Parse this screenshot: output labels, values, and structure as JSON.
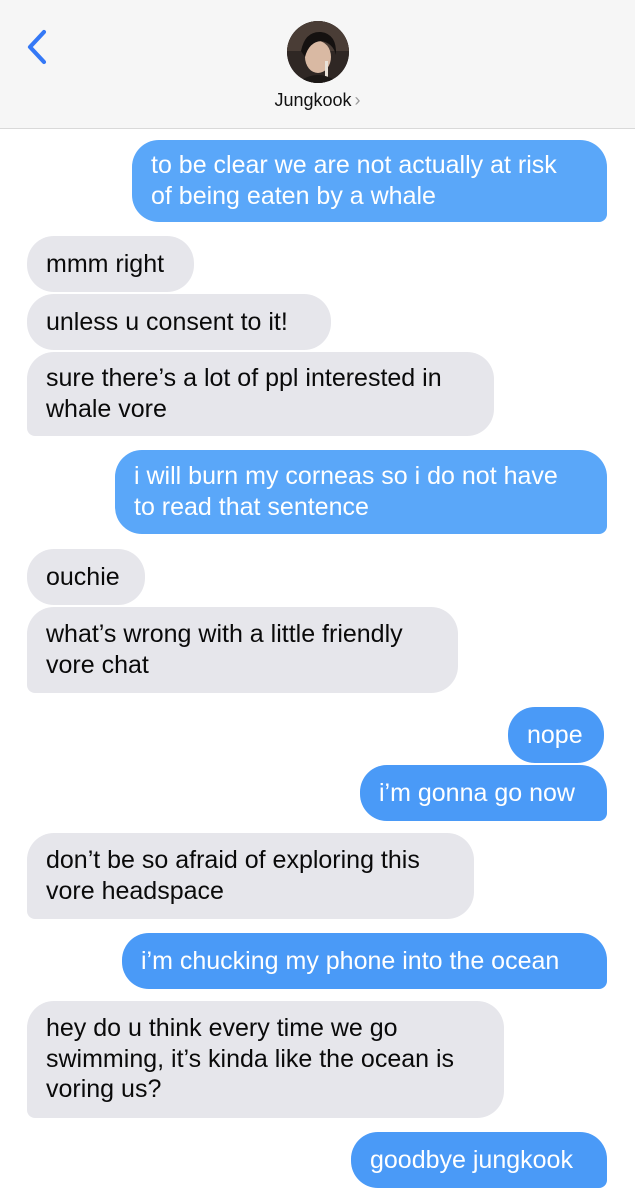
{
  "header": {
    "back_icon": "chevron-left-icon",
    "contact_name": "Jungkook",
    "contact_chevron": "›",
    "accent": "#3478f6"
  },
  "colors": {
    "incoming_bubble": "#e6e6eb",
    "outgoing_bubble": "#4a9af7"
  },
  "messages": [
    {
      "dir": "out",
      "text": "to be clear we are not actually at risk\nof being eaten by a whale"
    },
    {
      "dir": "in",
      "text": "mmm right"
    },
    {
      "dir": "in",
      "text": "unless u consent to it!"
    },
    {
      "dir": "in",
      "text": "sure there’s a lot of ppl interested in\nwhale vore"
    },
    {
      "dir": "out",
      "text": "i will burn my corneas so i do not have\nto read that sentence"
    },
    {
      "dir": "in",
      "text": "ouchie"
    },
    {
      "dir": "in",
      "text": "what’s wrong with a little friendly\nvore chat"
    },
    {
      "dir": "out",
      "text": "nope"
    },
    {
      "dir": "out",
      "text": "i’m gonna go now"
    },
    {
      "dir": "in",
      "text": "don’t be so afraid of exploring this\nvore headspace"
    },
    {
      "dir": "out",
      "text": "i’m chucking my phone into the ocean"
    },
    {
      "dir": "in",
      "text": "hey do u think every time we go\nswimming, it’s kinda like the ocean is\nvoring us?"
    },
    {
      "dir": "out",
      "text": "goodbye jungkook"
    }
  ]
}
